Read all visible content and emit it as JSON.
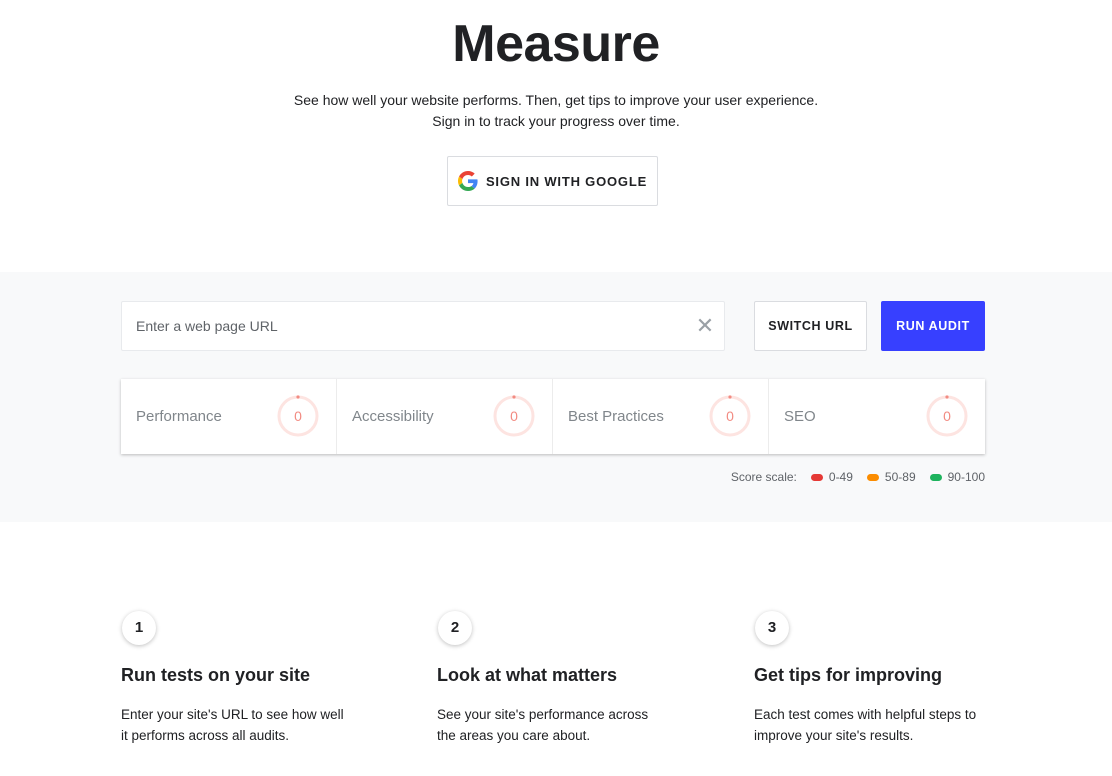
{
  "hero": {
    "title": "Measure",
    "subtitle_line1": "See how well your website performs. Then, get tips to improve your user experience.",
    "subtitle_line2": "Sign in to track your progress over time.",
    "google_button_label": "SIGN IN WITH GOOGLE",
    "google_icon": "google-g-icon"
  },
  "audit": {
    "url_placeholder": "Enter a web page URL",
    "url_value": "",
    "clear_icon": "close-icon",
    "switch_label": "SWITCH URL",
    "run_label": "RUN AUDIT",
    "accent_color": "#3740ff",
    "scores": [
      {
        "label": "Performance",
        "value": "0"
      },
      {
        "label": "Accessibility",
        "value": "0"
      },
      {
        "label": "Best Practices",
        "value": "0"
      },
      {
        "label": "SEO",
        "value": "0"
      }
    ],
    "scale": {
      "label": "Score scale:",
      "ranges": [
        {
          "label": "0-49",
          "color": "#e53935"
        },
        {
          "label": "50-89",
          "color": "#fb8c00"
        },
        {
          "label": "90-100",
          "color": "#1db35d"
        }
      ]
    }
  },
  "steps": [
    {
      "number": "1",
      "title": "Run tests on your site",
      "desc": "Enter your site's URL to see how well it performs across all audits."
    },
    {
      "number": "2",
      "title": "Look at what matters",
      "desc": "See your site's performance across the areas you care about."
    },
    {
      "number": "3",
      "title": "Get tips for improving",
      "desc": "Each test comes with helpful steps to improve your site's results."
    }
  ]
}
